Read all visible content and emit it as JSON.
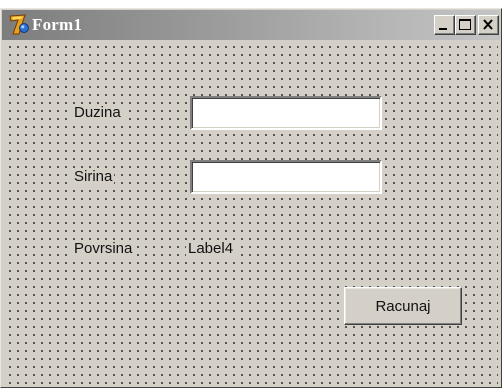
{
  "window": {
    "title": "Form1",
    "title_icon": "delphi-app-icon",
    "controls": {
      "minimize_icon": "minimize-icon",
      "maximize_icon": "maximize-icon",
      "close_icon": "close-icon"
    }
  },
  "form": {
    "duzina_label": "Duzina",
    "duzina_value": "",
    "sirina_label": "Sirina",
    "sirina_value": "",
    "povrsina_label": "Povrsina",
    "result_label": "Label4",
    "calculate_button": "Racunaj"
  },
  "colors": {
    "form_background": "#d4d0c8",
    "titlebar_inactive_start": "#7d7d7d",
    "titlebar_inactive_end": "#c4c4c4",
    "grid_dots": "#1a1a1a",
    "title_text": "#ffffff"
  }
}
